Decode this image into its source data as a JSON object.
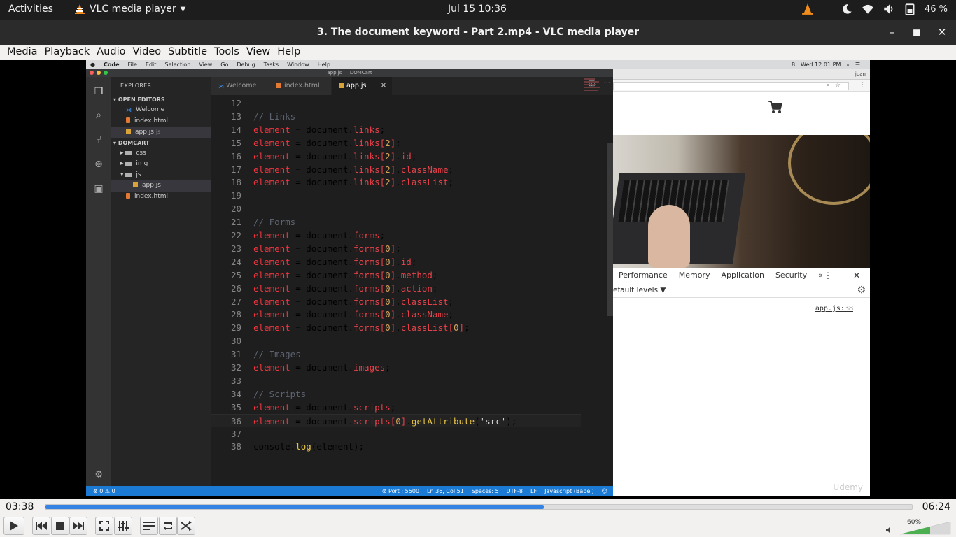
{
  "system_bar": {
    "activities": "Activities",
    "app_name": "VLC media player",
    "clock": "Jul 15  10:36",
    "battery": "46 %"
  },
  "window": {
    "title": "3. The document keyword  - Part 2.mp4 - VLC media player"
  },
  "menu": {
    "items": [
      "Media",
      "Playback",
      "Audio",
      "Video",
      "Subtitle",
      "Tools",
      "View",
      "Help"
    ]
  },
  "mac_menu": {
    "items": [
      "Code",
      "File",
      "Edit",
      "Selection",
      "View",
      "Go",
      "Debug",
      "Tasks",
      "Window",
      "Help"
    ],
    "time": "Wed 12:01 PM",
    "battery_num": "8"
  },
  "vscode": {
    "title": "app.js — DOMCart",
    "explorer_label": "EXPLORER",
    "open_editors_label": "OPEN EDITORS",
    "open_editors": [
      "Welcome",
      "index.html",
      "app.js"
    ],
    "open_editor_sub": "js",
    "project_label": "DOMCART",
    "tree": [
      "css",
      "img",
      "js",
      "app.js",
      "index.html"
    ],
    "tabs": [
      "Welcome",
      "index.html",
      "app.js"
    ],
    "code_lines": [
      {
        "n": "12",
        "t": ""
      },
      {
        "n": "13",
        "t": "// Links"
      },
      {
        "n": "14",
        "t": "element = document.links;"
      },
      {
        "n": "15",
        "t": "element = document.links[2];"
      },
      {
        "n": "16",
        "t": "element = document.links[2].id;"
      },
      {
        "n": "17",
        "t": "element = document.links[2].className;"
      },
      {
        "n": "18",
        "t": "element = document.links[2].classList;"
      },
      {
        "n": "19",
        "t": ""
      },
      {
        "n": "20",
        "t": ""
      },
      {
        "n": "21",
        "t": "// Forms"
      },
      {
        "n": "22",
        "t": "element = document.forms;"
      },
      {
        "n": "23",
        "t": "element = document.forms[0];"
      },
      {
        "n": "24",
        "t": "element = document.forms[0].id;"
      },
      {
        "n": "25",
        "t": "element = document.forms[0].method;"
      },
      {
        "n": "26",
        "t": "element = document.forms[0].action;"
      },
      {
        "n": "27",
        "t": "element = document.forms[0].classList;"
      },
      {
        "n": "28",
        "t": "element = document.forms[0].className;"
      },
      {
        "n": "29",
        "t": "element = document.forms[0].classList[0];"
      },
      {
        "n": "30",
        "t": ""
      },
      {
        "n": "31",
        "t": "// Images"
      },
      {
        "n": "32",
        "t": "element = document.images;"
      },
      {
        "n": "33",
        "t": ""
      },
      {
        "n": "34",
        "t": "// Scripts"
      },
      {
        "n": "35",
        "t": "element = document.scripts;"
      },
      {
        "n": "36",
        "t": "element = document.scripts[0].getAttribute('src');"
      },
      {
        "n": "37",
        "t": ""
      },
      {
        "n": "38",
        "t": "console.log(element);"
      }
    ],
    "current_line": "36",
    "status": {
      "problems": "⊗ 0 ⚠ 0",
      "port": "⊘ Port : 5500",
      "position": "Ln 36, Col 51",
      "spaces": "Spaces: 5",
      "encoding": "UTF-8",
      "eol": "LF",
      "language": "Javascript (Babel)"
    }
  },
  "browser": {
    "user": "juan",
    "devtools_tabs": [
      "Performance",
      "Memory",
      "Application",
      "Security",
      "»"
    ],
    "levels": "efault levels ▼",
    "source_link": "app.js:38",
    "watermark": "Udemy"
  },
  "player": {
    "elapsed": "03:38",
    "total": "06:24",
    "progress": 0.575,
    "volume": "60%"
  },
  "colors": {
    "seek_fill": "#3584e4",
    "vscode_status": "#1a7ad4"
  }
}
